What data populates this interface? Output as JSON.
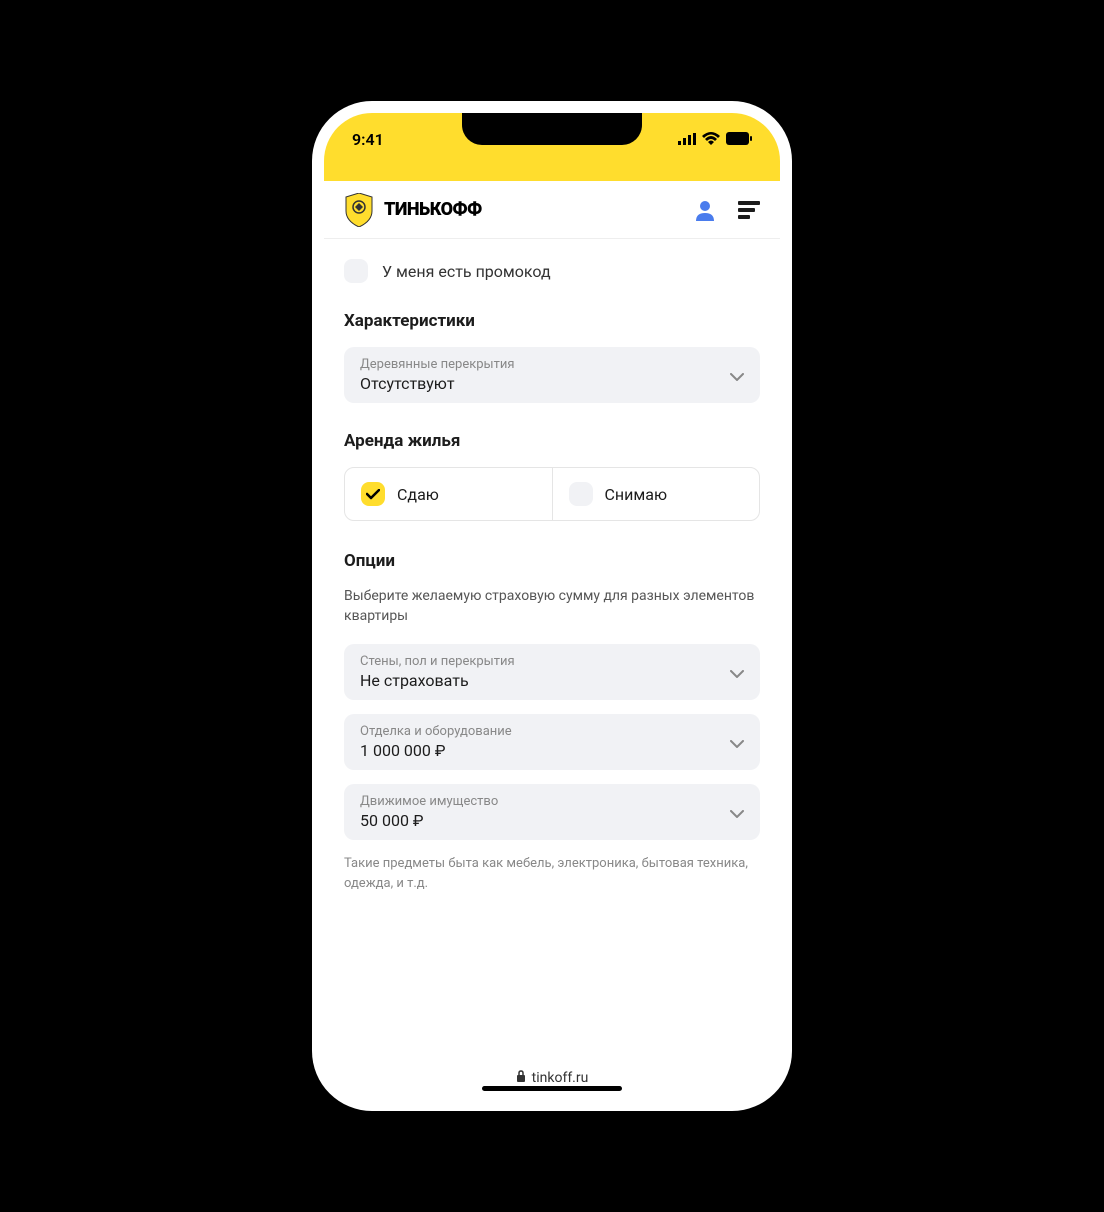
{
  "status": {
    "time": "9:41"
  },
  "header": {
    "brand": "ТИНЬКОФФ"
  },
  "promo": {
    "label": "У меня есть промокод"
  },
  "characteristics": {
    "title": "Характеристики",
    "floor": {
      "label": "Деревянные перекрытия",
      "value": "Отсутствуют"
    }
  },
  "rental": {
    "title": "Аренда жилья",
    "options": [
      {
        "label": "Сдаю",
        "checked": true
      },
      {
        "label": "Снимаю",
        "checked": false
      }
    ]
  },
  "options": {
    "title": "Опции",
    "subtitle": "Выберите желаемую страховую сумму для разных элементов квартиры",
    "items": [
      {
        "label": "Стены, пол и перекрытия",
        "value": "Не страховать"
      },
      {
        "label": "Отделка и оборудование",
        "value": "1 000 000 ₽"
      },
      {
        "label": "Движимое имущество",
        "value": "50 000 ₽"
      }
    ],
    "helper": "Такие предметы быта как мебель, электроника, бытовая техника, одежда, и т.д."
  },
  "browser": {
    "url": "tinkoff.ru"
  }
}
